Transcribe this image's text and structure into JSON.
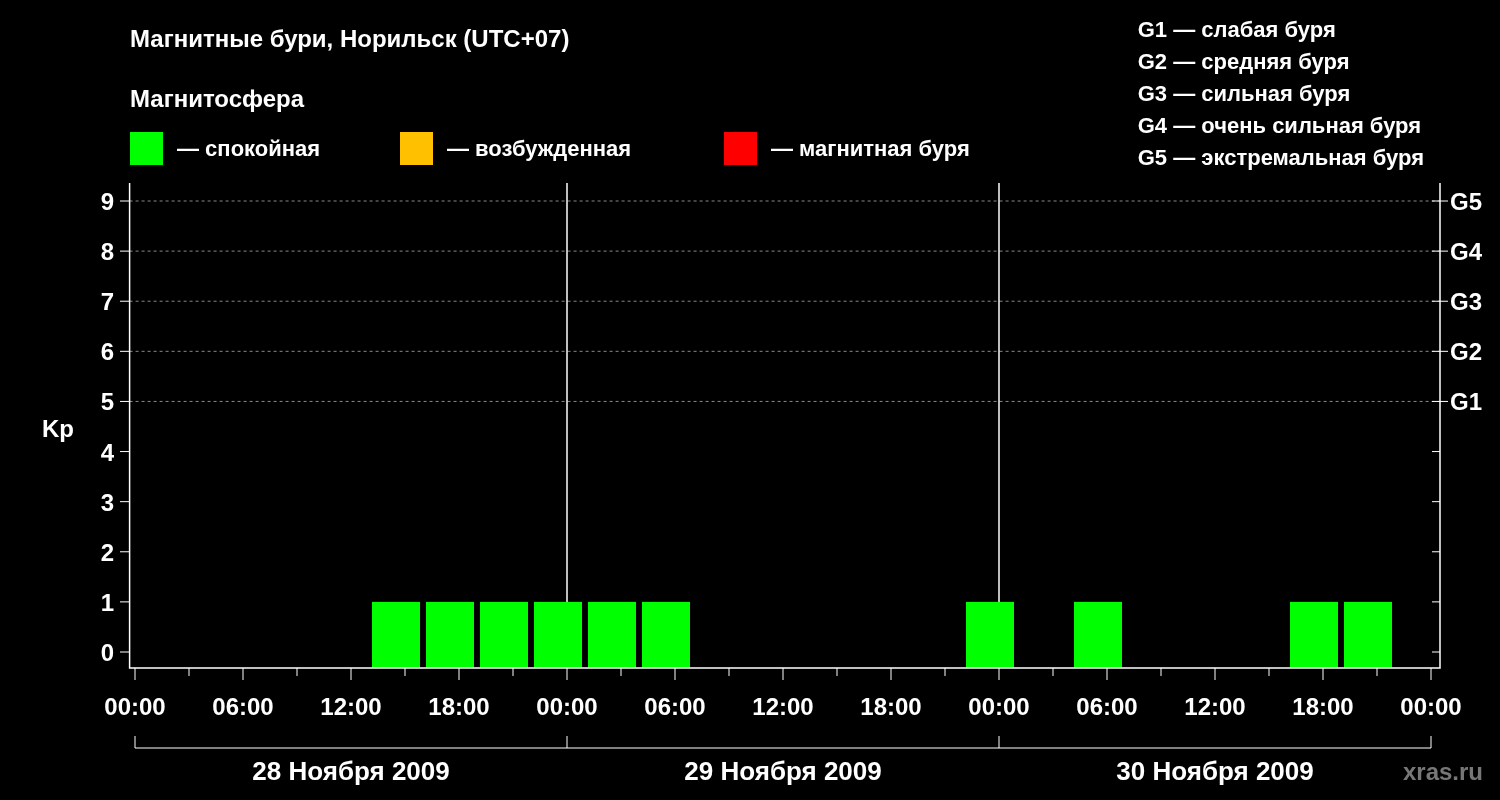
{
  "title": "Магнитные бури, Норильск (UTC+07)",
  "legend": {
    "title": "Магнитосфера",
    "items": [
      {
        "label": "— спокойная",
        "color": "#00ff00"
      },
      {
        "label": "— возбужденная",
        "color": "#ffc000"
      },
      {
        "label": "— магнитная буря",
        "color": "#ff0000"
      }
    ]
  },
  "g_scale": [
    "G1 — слабая буря",
    "G2 — средняя буря",
    "G3 — сильная буря",
    "G4 — очень сильная буря",
    "G5 — экстремальная буря"
  ],
  "chart": {
    "right_axis_labels": [
      "G5",
      "G4",
      "G3",
      "G2",
      "G1"
    ],
    "more_x_axis_labels": [
      "00:00",
      "06:00",
      "12:00",
      "18:00",
      "00:00",
      "06:00",
      "12:00",
      "18:00",
      "00:00"
    ],
    "day_labels": [
      "28 Ноября 2009",
      "29 Ноября 2009",
      "30 Ноября 2009"
    ],
    "credit": "xras.ru",
    "chart_data": {
      "type": "bar",
      "ylabel": "Kp",
      "x": [
        14.5,
        17.5,
        20.5,
        23.5,
        26.5,
        29.5,
        47.5,
        53.5,
        65.5,
        68.5
      ],
      "series": [
        {
          "color": "#00ff00",
          "values": [
            1,
            1,
            1,
            1,
            1,
            1,
            1,
            1,
            1,
            1
          ]
        }
      ],
      "xlim": [
        -0.3,
        72.5
      ],
      "ylim": [
        0,
        9
      ],
      "grid": true,
      "ref_lines": [
        {
          "axis": "x",
          "value": 24
        },
        {
          "axis": "x",
          "value": 48
        }
      ],
      "xticks": [
        {
          "value": 0,
          "label": "00:00"
        },
        {
          "value": 6,
          "label": "06:00"
        },
        {
          "value": 12,
          "label": "12:00"
        },
        {
          "value": 18,
          "label": "18:00"
        }
      ],
      "yticks": [
        {
          "value": 0,
          "label": "0"
        },
        {
          "value": 1,
          "label": "1"
        },
        {
          "value": 2,
          "label": "2"
        },
        {
          "value": 3,
          "label": "3"
        },
        {
          "value": 4,
          "label": "4"
        },
        {
          "value": 5,
          "label": "5"
        },
        {
          "value": 6,
          "label": "6"
        },
        {
          "value": 7,
          "label": "7"
        },
        {
          "value": 8,
          "label": "8"
        },
        {
          "value": 9,
          "label": "9"
        }
      ]
    }
  }
}
